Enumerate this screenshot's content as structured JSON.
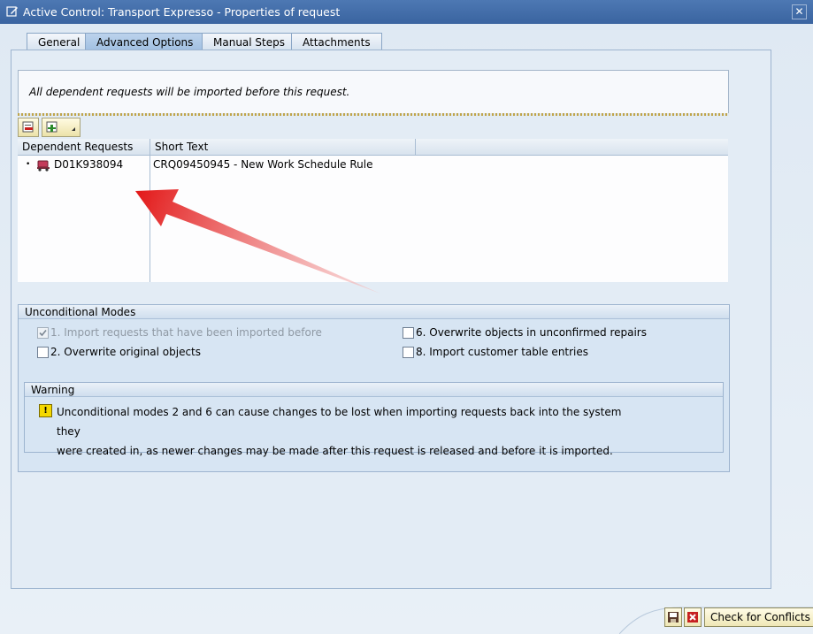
{
  "window": {
    "title": "Active Control: Transport Expresso - Properties of request",
    "close_glyph": "✕"
  },
  "tabs": [
    {
      "label": "General",
      "active": false
    },
    {
      "label": "Advanced Options",
      "active": true
    },
    {
      "label": "Manual Steps",
      "active": false
    },
    {
      "label": "Attachments",
      "active": false
    }
  ],
  "info": {
    "message": "All dependent requests will be imported before this request."
  },
  "toolbar": {
    "icons": [
      "remove-row-icon",
      "add-row-icon"
    ]
  },
  "grid": {
    "columns": [
      "Dependent Requests",
      "Short Text"
    ],
    "rows": [
      {
        "request": "D01K938094",
        "short_text": "CRQ09450945 - New Work Schedule Rule",
        "icon": "transport-truck-icon"
      }
    ]
  },
  "unconditional_modes": {
    "title": "Unconditional Modes",
    "options": [
      {
        "label": "1. Import requests that have been imported before",
        "checked": true,
        "disabled": true
      },
      {
        "label": "6. Overwrite objects in unconfirmed repairs",
        "checked": false,
        "disabled": false
      },
      {
        "label": "2. Overwrite original objects",
        "checked": false,
        "disabled": false
      },
      {
        "label": "8. Import customer table entries",
        "checked": false,
        "disabled": false
      }
    ]
  },
  "warning": {
    "title": "Warning",
    "line1": "Unconditional modes 2 and 6 can cause changes to be lost when importing requests back into the system they",
    "line2": "were created in, as newer changes may be made after this request is released and before it is imported.",
    "icon_glyph": "!"
  },
  "footer": {
    "check_conflicts_label": "Check for Conflicts",
    "icons": [
      "save-icon",
      "cancel-icon"
    ]
  },
  "colors": {
    "title_bar": "#3a64a0",
    "arrow": "#e31b1b",
    "warning_icon": "#f5d800"
  }
}
